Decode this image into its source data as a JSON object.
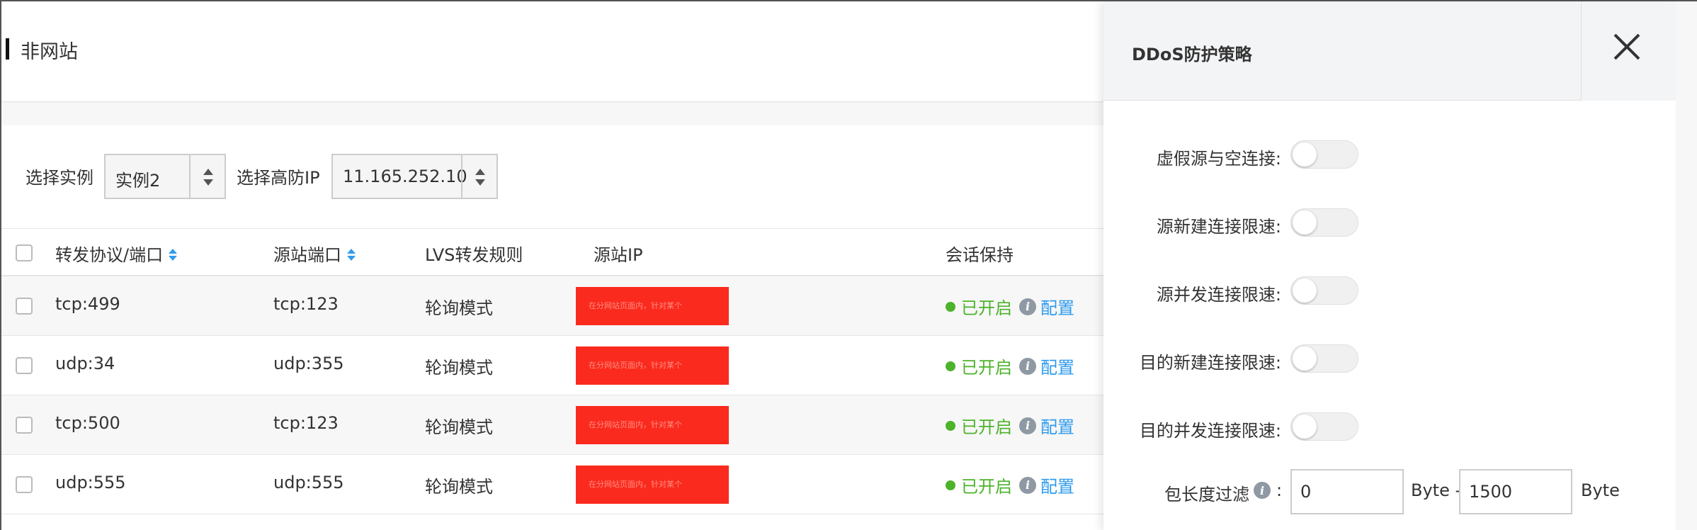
{
  "page": {
    "title": "非网站"
  },
  "filters": {
    "instance_label": "选择实例",
    "instance_value": "实例2",
    "ip_label": "选择高防IP",
    "ip_value": "11.165.252.10"
  },
  "table": {
    "headers": {
      "protocol_port": "转发协议/端口",
      "source_port": "源站端口",
      "lvs_rule": "LVS转发规则",
      "source_ip": "源站IP",
      "session": "会话保持"
    },
    "rows": [
      {
        "protocol_port": "tcp:499",
        "source_port": "tcp:123",
        "lvs_rule": "轮询模式",
        "redacted_text": "在分网站页面内，针对某个",
        "status": "已开启",
        "config": "配置"
      },
      {
        "protocol_port": "udp:34",
        "source_port": "udp:355",
        "lvs_rule": "轮询模式",
        "redacted_text": "在分网站页面内，针对某个",
        "status": "已开启",
        "config": "配置"
      },
      {
        "protocol_port": "tcp:500",
        "source_port": "tcp:123",
        "lvs_rule": "轮询模式",
        "redacted_text": "在分网站页面内，针对某个",
        "status": "已开启",
        "config": "配置"
      },
      {
        "protocol_port": "udp:555",
        "source_port": "udp:555",
        "lvs_rule": "轮询模式",
        "redacted_text": "在分网站页面内，针对某个",
        "status": "已开启",
        "config": "配置"
      }
    ]
  },
  "panel": {
    "title": "DDoS防护策略",
    "toggles": [
      {
        "label": "虚假源与空连接:",
        "on": false
      },
      {
        "label": "源新建连接限速:",
        "on": false
      },
      {
        "label": "源并发连接限速:",
        "on": false
      },
      {
        "label": "目的新建连接限速:",
        "on": false
      },
      {
        "label": "目的并发连接限速:",
        "on": false
      }
    ],
    "packet_filter": {
      "label": "包长度过滤",
      "colon": ":",
      "min_value": "0",
      "separator": "Byte -",
      "max_value": "1500",
      "unit": "Byte"
    }
  },
  "colors": {
    "accent": "#2f9bee",
    "status_green": "#4cb32a",
    "redaction": "#fb2a1e"
  }
}
